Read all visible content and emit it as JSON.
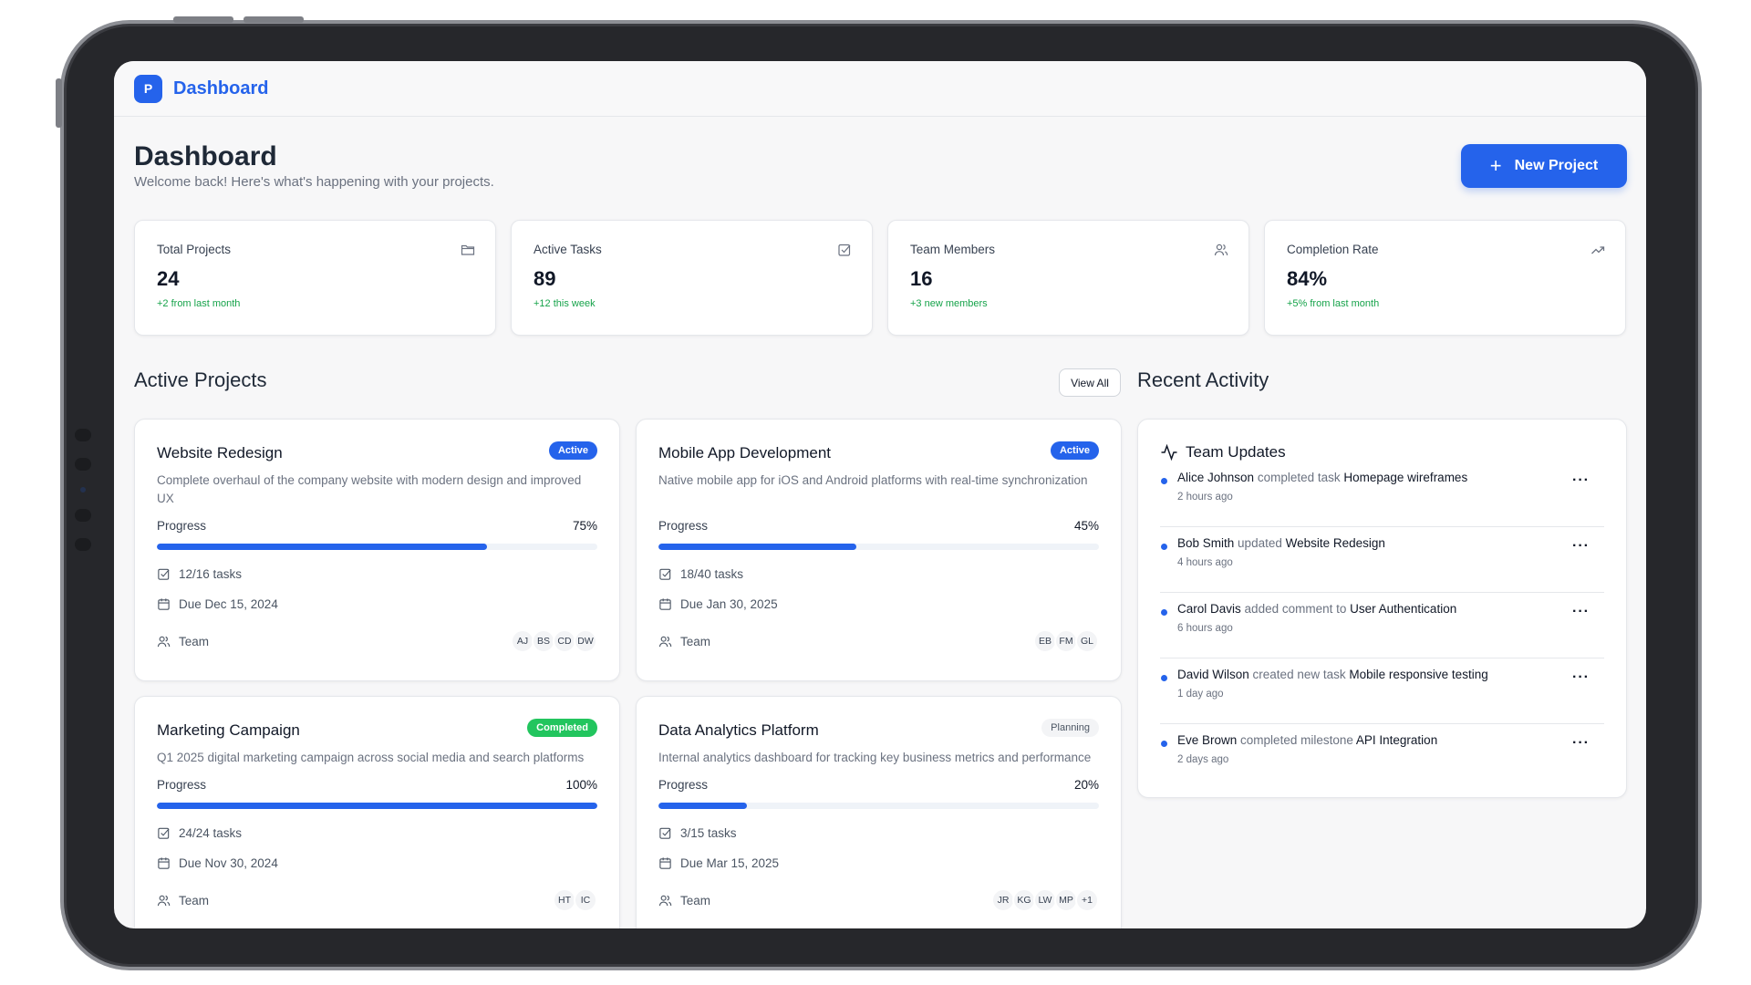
{
  "app": {
    "logo_letter": "P",
    "brand": "Dashboard"
  },
  "header": {
    "title": "Dashboard",
    "subtitle": "Welcome back! Here's what's happening with your projects.",
    "new_project_label": "New Project"
  },
  "stats": [
    {
      "label": "Total Projects",
      "value": "24",
      "delta": "+2 from last month",
      "icon": "folder-icon"
    },
    {
      "label": "Active Tasks",
      "value": "89",
      "delta": "+12 this week",
      "icon": "check-square-icon"
    },
    {
      "label": "Team Members",
      "value": "16",
      "delta": "+3 new members",
      "icon": "users-icon"
    },
    {
      "label": "Completion Rate",
      "value": "84%",
      "delta": "+5% from last month",
      "icon": "trending-up-icon"
    }
  ],
  "projects_section": {
    "title": "Active Projects",
    "view_all_label": "View All"
  },
  "projects": [
    {
      "title": "Website Redesign",
      "status": "Active",
      "description": "Complete overhaul of the company website with modern design and improved UX",
      "progress_label": "Progress",
      "progress_pct": "75%",
      "progress": 0.75,
      "tasks": "12/16 tasks",
      "due": "Due Dec 15, 2024",
      "team_label": "Team",
      "members": [
        "AJ",
        "BS",
        "CD",
        "DW"
      ]
    },
    {
      "title": "Mobile App Development",
      "status": "Active",
      "description": "Native mobile app for iOS and Android platforms with real-time synchronization",
      "progress_label": "Progress",
      "progress_pct": "45%",
      "progress": 0.45,
      "tasks": "18/40 tasks",
      "due": "Due Jan 30, 2025",
      "team_label": "Team",
      "members": [
        "EB",
        "FM",
        "GL"
      ]
    },
    {
      "title": "Marketing Campaign",
      "status": "Completed",
      "description": "Q1 2025 digital marketing campaign across social media and search platforms",
      "progress_label": "Progress",
      "progress_pct": "100%",
      "progress": 1.0,
      "tasks": "24/24 tasks",
      "due": "Due Nov 30, 2024",
      "team_label": "Team",
      "members": [
        "HT",
        "IC"
      ]
    },
    {
      "title": "Data Analytics Platform",
      "status": "Planning",
      "description": "Internal analytics dashboard for tracking key business metrics and performance",
      "progress_label": "Progress",
      "progress_pct": "20%",
      "progress": 0.2,
      "tasks": "3/15 tasks",
      "due": "Due Mar 15, 2025",
      "team_label": "Team",
      "members": [
        "JR",
        "KG",
        "LW",
        "MP",
        "+1"
      ]
    }
  ],
  "activity_section": {
    "title": "Recent Activity",
    "card_title": "Team Updates",
    "items": [
      {
        "user": "Alice Johnson",
        "action": "completed task",
        "target": "Homepage wireframes",
        "time": "2 hours ago"
      },
      {
        "user": "Bob Smith",
        "action": "updated",
        "target": "Website Redesign",
        "time": "4 hours ago"
      },
      {
        "user": "Carol Davis",
        "action": "added comment to",
        "target": "User Authentication",
        "time": "6 hours ago"
      },
      {
        "user": "David Wilson",
        "action": "created new task",
        "target": "Mobile responsive testing",
        "time": "1 day ago"
      },
      {
        "user": "Eve Brown",
        "action": "completed milestone",
        "target": "API Integration",
        "time": "2 days ago"
      }
    ]
  },
  "colors": {
    "accent": "#2563eb",
    "success": "#22c55e",
    "delta": "#16a34a"
  }
}
